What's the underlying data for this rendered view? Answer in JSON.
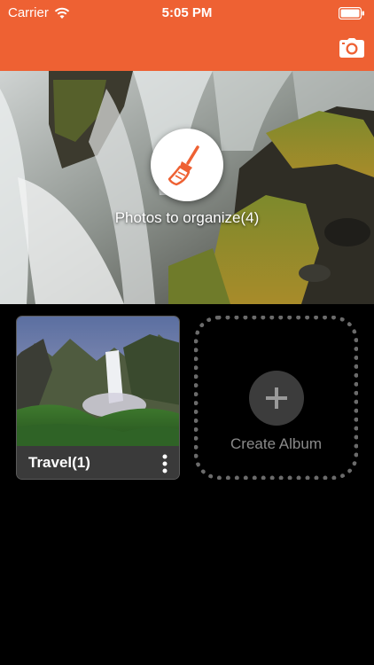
{
  "status_bar": {
    "carrier": "Carrier",
    "time": "5:05 PM",
    "wifi_icon": "wifi-icon",
    "battery_icon": "battery-icon"
  },
  "nav": {
    "camera_icon": "camera-icon",
    "accent_color": "#ee6133"
  },
  "hero": {
    "caption": "Photos to organize(4)",
    "clean_icon": "broom-icon"
  },
  "albums": [
    {
      "name": "Travel(1)",
      "menu_icon": "more-vertical-icon"
    }
  ],
  "create_album": {
    "label": "Create Album",
    "icon": "plus-icon"
  }
}
